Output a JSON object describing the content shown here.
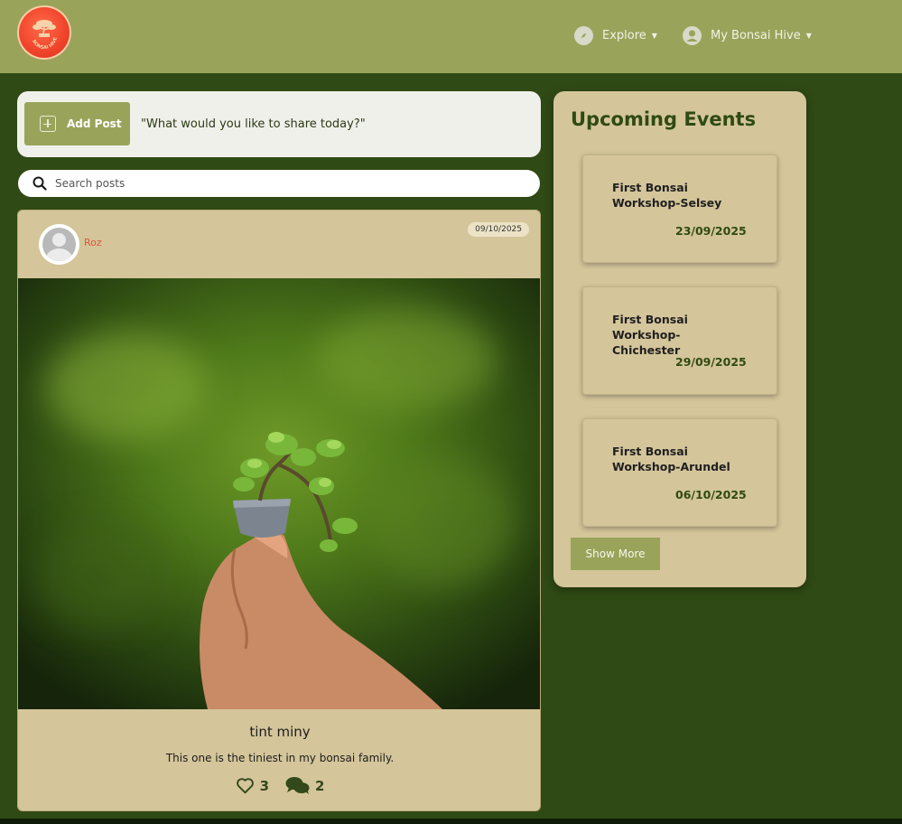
{
  "navbar": {
    "logo_text": "BONSAI HIVE",
    "explore_label": "Explore",
    "hive_label": "My Bonsai Hive"
  },
  "composer": {
    "add_post_label": "Add Post",
    "prompt": "\"What would you like to share today?\""
  },
  "search": {
    "placeholder": "Search posts"
  },
  "post": {
    "author": "Roz",
    "date": "09/10/2025",
    "title": "tint miny",
    "body": "This one is the tiniest in my bonsai family.",
    "likes": "3",
    "comments": "2"
  },
  "events": {
    "title": "Upcoming Events",
    "items": [
      {
        "name": "First Bonsai Workshop-Selsey",
        "date": "23/09/2025"
      },
      {
        "name": "First Bonsai Workshop-Chichester",
        "date": "29/09/2025"
      },
      {
        "name": "First Bonsai Workshop-Arundel",
        "date": "06/10/2025"
      }
    ],
    "show_more_label": "Show More"
  },
  "colors": {
    "background": "#2f4a14",
    "navbar": "#99a45a",
    "card": "#d4c59a",
    "author": "#e3533d"
  }
}
